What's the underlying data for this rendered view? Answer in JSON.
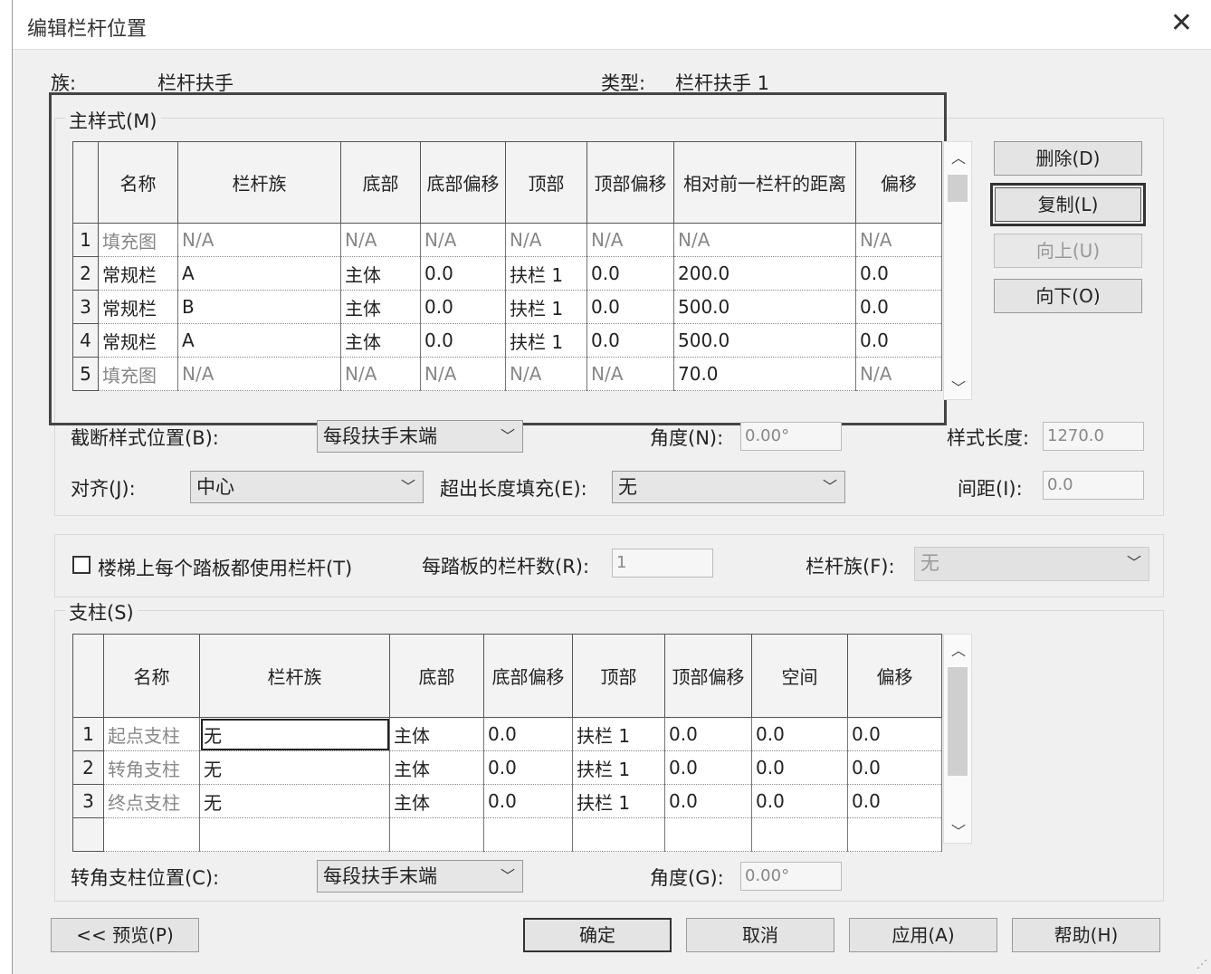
{
  "window": {
    "title": "编辑栏杆位置",
    "close_glyph": "✕"
  },
  "family": {
    "label": "族:",
    "value": "栏杆扶手"
  },
  "type": {
    "label": "类型:",
    "value": "栏杆扶手 1"
  },
  "main_pattern": {
    "group_label": "主样式(M)",
    "columns": [
      "名称",
      "栏杆族",
      "底部",
      "底部偏移",
      "顶部",
      "顶部偏移",
      "相对前一栏杆的距离",
      "偏移"
    ],
    "rows": [
      {
        "n": "1",
        "name": "填充图",
        "family": "N/A",
        "base": "N/A",
        "base_offset": "N/A",
        "top": "N/A",
        "top_offset": "N/A",
        "dist": "N/A",
        "offset": "N/A"
      },
      {
        "n": "2",
        "name": "常规栏",
        "family": "A",
        "base": "主体",
        "base_offset": "0.0",
        "top": "扶栏 1",
        "top_offset": "0.0",
        "dist": "200.0",
        "offset": "0.0"
      },
      {
        "n": "3",
        "name": "常规栏",
        "family": "B",
        "base": "主体",
        "base_offset": "0.0",
        "top": "扶栏 1",
        "top_offset": "0.0",
        "dist": "500.0",
        "offset": "0.0"
      },
      {
        "n": "4",
        "name": "常规栏",
        "family": "A",
        "base": "主体",
        "base_offset": "0.0",
        "top": "扶栏 1",
        "top_offset": "0.0",
        "dist": "500.0",
        "offset": "0.0"
      },
      {
        "n": "5",
        "name": "填充图",
        "family": "N/A",
        "base": "N/A",
        "base_offset": "N/A",
        "top": "N/A",
        "top_offset": "N/A",
        "dist": "70.0",
        "offset": "N/A"
      }
    ]
  },
  "buttons_side": {
    "delete": "删除(D)",
    "copy": "复制(L)",
    "up": "向上(U)",
    "down": "向下(O)"
  },
  "break_pattern": {
    "label": "截断样式位置(B):",
    "value": "每段扶手末端"
  },
  "angle_n": {
    "label": "角度(N):",
    "value": "0.00°"
  },
  "pattern_length": {
    "label": "样式长度:",
    "value": "1270.0"
  },
  "justify": {
    "label": "对齐(J):",
    "value": "中心"
  },
  "excess_fill": {
    "label": "超出长度填充(E):",
    "value": "无"
  },
  "spacing": {
    "label": "间距(I):",
    "value": "0.0"
  },
  "per_tread": {
    "label": "楼梯上每个踏板都使用栏杆(T)",
    "checked": false
  },
  "balusters_per_tread": {
    "label": "每踏板的栏杆数(R):",
    "value": "1"
  },
  "baluster_family": {
    "label": "栏杆族(F):",
    "value": "无"
  },
  "posts": {
    "group_label": "支柱(S)",
    "columns": [
      "名称",
      "栏杆族",
      "底部",
      "底部偏移",
      "顶部",
      "顶部偏移",
      "空间",
      "偏移"
    ],
    "rows": [
      {
        "n": "1",
        "name": "起点支柱",
        "family": "无",
        "base": "主体",
        "base_offset": "0.0",
        "top": "扶栏 1",
        "top_offset": "0.0",
        "space": "0.0",
        "offset": "0.0"
      },
      {
        "n": "2",
        "name": "转角支柱",
        "family": "无",
        "base": "主体",
        "base_offset": "0.0",
        "top": "扶栏 1",
        "top_offset": "0.0",
        "space": "0.0",
        "offset": "0.0"
      },
      {
        "n": "3",
        "name": "终点支柱",
        "family": "无",
        "base": "主体",
        "base_offset": "0.0",
        "top": "扶栏 1",
        "top_offset": "0.0",
        "space": "0.0",
        "offset": "0.0"
      }
    ]
  },
  "corner_posts": {
    "label": "转角支柱位置(C):",
    "value": "每段扶手末端"
  },
  "angle_g": {
    "label": "角度(G):",
    "value": "0.00°"
  },
  "footer": {
    "preview": "<< 预览(P)",
    "ok": "确定",
    "cancel": "取消",
    "apply": "应用(A)",
    "help": "帮助(H)"
  }
}
